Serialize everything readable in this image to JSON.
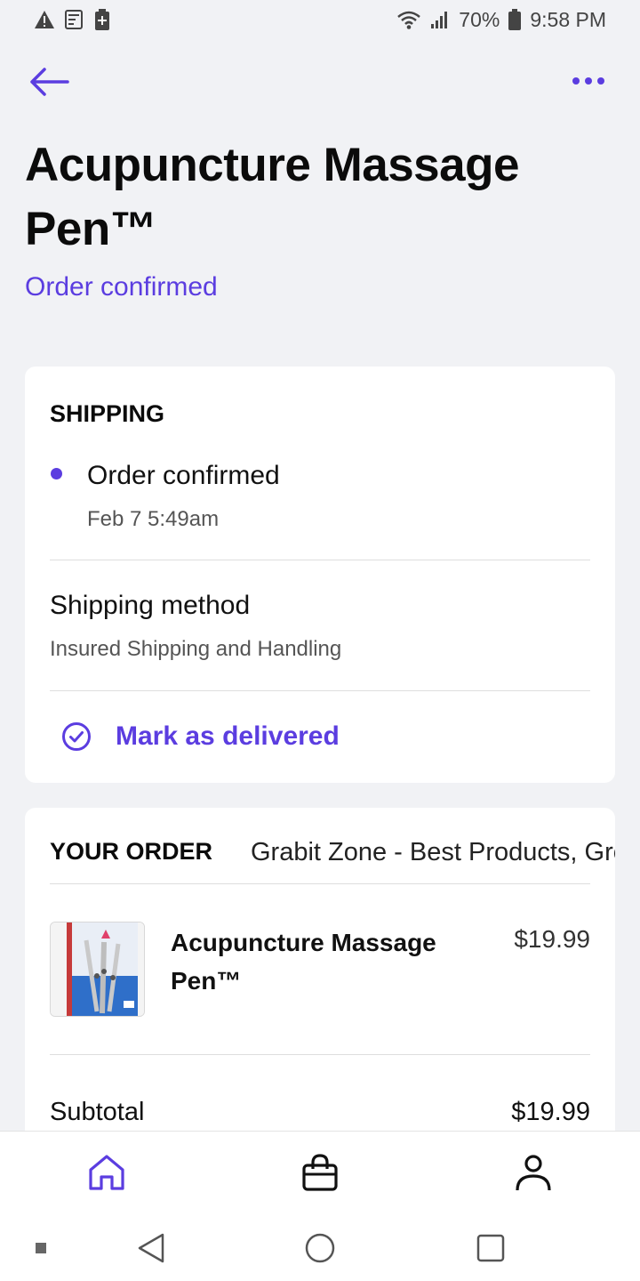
{
  "status_bar": {
    "battery": "70%",
    "time": "9:58 PM"
  },
  "header": {
    "back_icon": "arrow-left-icon",
    "more_icon": "more-horizontal-icon"
  },
  "product": {
    "title": "Acupuncture Massage Pen™",
    "status": "Order confirmed"
  },
  "shipping": {
    "heading": "SHIPPING",
    "timeline_status": "Order confirmed",
    "timeline_date": "Feb 7 5:49am",
    "method_label": "Shipping method",
    "method_value": "Insured Shipping and Handling",
    "mark_delivered": "Mark as delivered"
  },
  "order": {
    "heading": "YOUR ORDER",
    "store": "Grabit Zone - Best Products, Great Prices",
    "item_name": "Acupuncture Massage Pen™",
    "item_price": "$19.99",
    "subtotal_label": "Subtotal",
    "subtotal_value": "$19.99"
  },
  "tabs": [
    "home-icon",
    "shopping-bag-icon",
    "profile-icon"
  ],
  "colors": {
    "accent": "#5b3de0",
    "background": "#f1f2f5"
  }
}
